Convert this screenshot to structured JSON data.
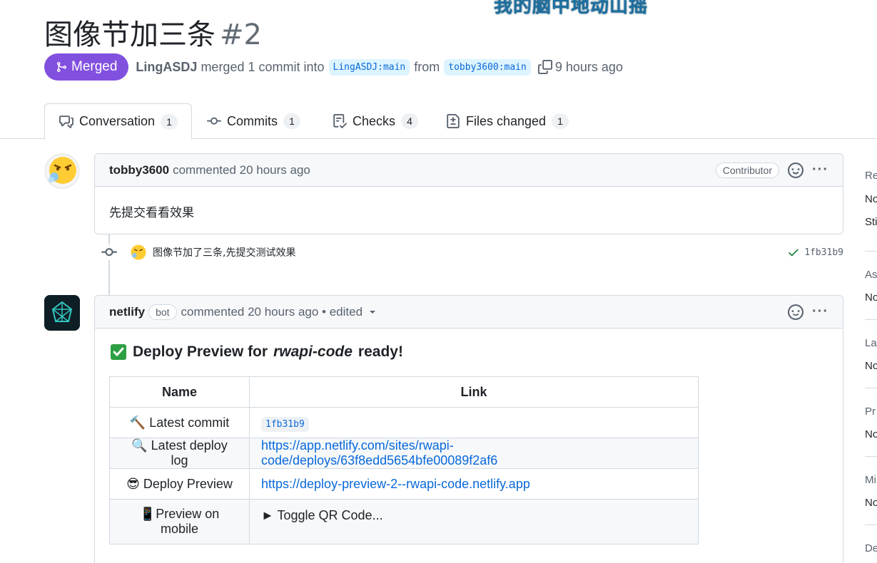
{
  "overlay": {
    "text": "我的脑中地动山摇"
  },
  "pr": {
    "title": "图像节加三条",
    "number": "#2",
    "state": "Merged",
    "author": "LingASDJ",
    "merged_text": "merged 1 commit into",
    "base_branch": "LingASDJ:main",
    "from_text": "from",
    "head_branch": "tobby3600:main",
    "time": "9 hours ago"
  },
  "tabs": [
    {
      "label": "Conversation",
      "count": "1",
      "icon": "comment-discussion-icon"
    },
    {
      "label": "Commits",
      "count": "1",
      "icon": "git-commit-icon"
    },
    {
      "label": "Checks",
      "count": "4",
      "icon": "checklist-icon"
    },
    {
      "label": "Files changed",
      "count": "1",
      "icon": "file-diff-icon"
    }
  ],
  "comment1": {
    "author": "tobby3600",
    "action": "commented 20 hours ago",
    "role": "Contributor",
    "body": "先提交看看效果"
  },
  "commit": {
    "message": "图像节加了三条,先提交测试效果",
    "sha": "1fb31b9"
  },
  "comment2": {
    "author": "netlify",
    "bot_label": "bot",
    "action": "commented 20 hours ago • edited",
    "deploy_prefix": "Deploy Preview for",
    "site": "rwapi-code",
    "deploy_suffix": "ready!",
    "table": {
      "headers": [
        "Name",
        "Link"
      ],
      "rows": [
        {
          "emoji": "🔨",
          "name": "Latest commit",
          "link": "1fb31b9"
        },
        {
          "emoji": "🔍",
          "name": "Latest deploy log",
          "link": "https://app.netlify.com/sites/rwapi-code/deploys/63f8edd5654bfe00089f2af6"
        },
        {
          "emoji": "😎",
          "name": "Deploy Preview",
          "link": "https://deploy-preview-2--rwapi-code.netlify.app"
        },
        {
          "emoji": "📱",
          "name": "Preview on mobile",
          "link": "► Toggle QR Code..."
        }
      ]
    }
  },
  "sidebar": {
    "items": [
      "Re",
      "No",
      "Sti",
      "As",
      "No",
      "La",
      "No",
      "Pr",
      "No",
      "Mi",
      "No",
      "De"
    ]
  },
  "colors": {
    "merged": "#8250df",
    "link": "#0969da",
    "success": "#1a7f37"
  }
}
